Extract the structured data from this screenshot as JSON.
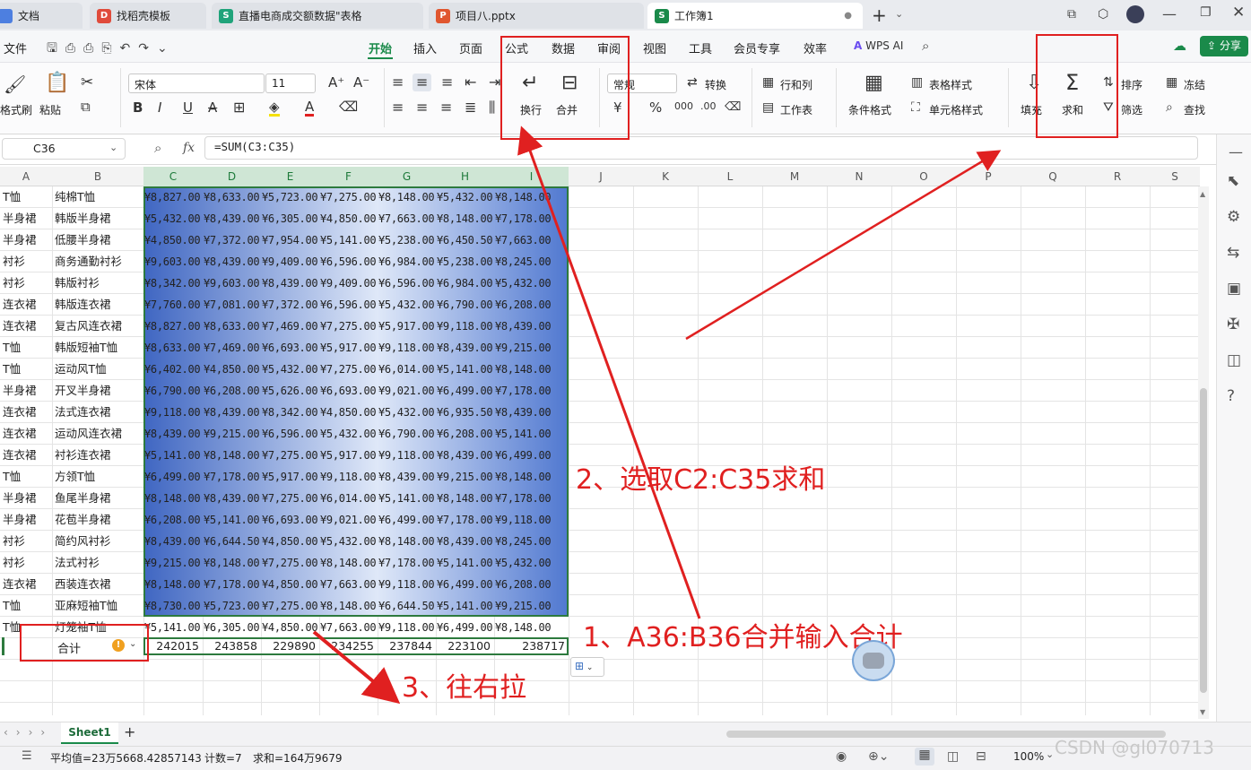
{
  "tabs": [
    {
      "label": "文档"
    },
    {
      "label": "找稻壳模板"
    },
    {
      "label": "直播电商成交额数据\"表格"
    },
    {
      "label": "项目八.pptx"
    },
    {
      "label": "工作簿1"
    }
  ],
  "menus": {
    "file": "文件",
    "items": [
      "开始",
      "插入",
      "页面",
      "公式",
      "数据",
      "审阅",
      "视图",
      "工具",
      "会员专享",
      "效率"
    ],
    "wps_ai": "WPS AI",
    "share": "分享"
  },
  "ribbon": {
    "format_painter": "格式刷",
    "paste": "粘贴",
    "font_name": "宋体",
    "font_size": "11",
    "wrap": "换行",
    "merge": "合并",
    "number_format": "常规",
    "convert": "转换",
    "rows_cols": "行和列",
    "worksheet": "工作表",
    "cond_format": "条件格式",
    "table_style": "表格样式",
    "cell_style": "单元格样式",
    "fill": "填充",
    "sum": "求和",
    "sort": "排序",
    "filter": "筛选",
    "freeze": "冻结",
    "find": "查找"
  },
  "formula_bar": {
    "cell_ref": "C36",
    "fx": "fx",
    "formula": "=SUM(C3:C35)"
  },
  "columns": [
    "A",
    "B",
    "C",
    "D",
    "E",
    "F",
    "G",
    "H",
    "I",
    "J",
    "K",
    "L",
    "M",
    "N",
    "O",
    "P",
    "Q",
    "R",
    "S"
  ],
  "rows": [
    [
      "T恤",
      "纯棉T恤",
      "¥8,827.00",
      "¥8,633.00",
      "¥5,723.00",
      "¥7,275.00",
      "¥8,148.00",
      "¥5,432.00",
      "¥8,148.00"
    ],
    [
      "半身裙",
      "韩版半身裙",
      "¥5,432.00",
      "¥8,439.00",
      "¥6,305.00",
      "¥4,850.00",
      "¥7,663.00",
      "¥8,148.00",
      "¥7,178.00"
    ],
    [
      "半身裙",
      "低腰半身裙",
      "¥4,850.00",
      "¥7,372.00",
      "¥7,954.00",
      "¥5,141.00",
      "¥5,238.00",
      "¥6,450.50",
      "¥7,663.00"
    ],
    [
      "衬衫",
      "商务通勤衬衫",
      "¥9,603.00",
      "¥8,439.00",
      "¥9,409.00",
      "¥6,596.00",
      "¥6,984.00",
      "¥5,238.00",
      "¥8,245.00"
    ],
    [
      "衬衫",
      "韩版衬衫",
      "¥8,342.00",
      "¥9,603.00",
      "¥8,439.00",
      "¥9,409.00",
      "¥6,596.00",
      "¥6,984.00",
      "¥5,432.00"
    ],
    [
      "连衣裙",
      "韩版连衣裙",
      "¥7,760.00",
      "¥7,081.00",
      "¥7,372.00",
      "¥6,596.00",
      "¥5,432.00",
      "¥6,790.00",
      "¥6,208.00"
    ],
    [
      "连衣裙",
      "复古风连衣裙",
      "¥8,827.00",
      "¥8,633.00",
      "¥7,469.00",
      "¥7,275.00",
      "¥5,917.00",
      "¥9,118.00",
      "¥8,439.00"
    ],
    [
      "T恤",
      "韩版短袖T恤",
      "¥8,633.00",
      "¥7,469.00",
      "¥6,693.00",
      "¥5,917.00",
      "¥9,118.00",
      "¥8,439.00",
      "¥9,215.00"
    ],
    [
      "T恤",
      "运动风T恤",
      "¥6,402.00",
      "¥4,850.00",
      "¥5,432.00",
      "¥7,275.00",
      "¥6,014.00",
      "¥5,141.00",
      "¥8,148.00"
    ],
    [
      "半身裙",
      "开叉半身裙",
      "¥6,790.00",
      "¥6,208.00",
      "¥5,626.00",
      "¥6,693.00",
      "¥9,021.00",
      "¥6,499.00",
      "¥7,178.00"
    ],
    [
      "连衣裙",
      "法式连衣裙",
      "¥9,118.00",
      "¥8,439.00",
      "¥8,342.00",
      "¥4,850.00",
      "¥5,432.00",
      "¥6,935.50",
      "¥8,439.00"
    ],
    [
      "连衣裙",
      "运动风连衣裙",
      "¥8,439.00",
      "¥9,215.00",
      "¥6,596.00",
      "¥5,432.00",
      "¥6,790.00",
      "¥6,208.00",
      "¥5,141.00"
    ],
    [
      "连衣裙",
      "衬衫连衣裙",
      "¥5,141.00",
      "¥8,148.00",
      "¥7,275.00",
      "¥5,917.00",
      "¥9,118.00",
      "¥8,439.00",
      "¥6,499.00"
    ],
    [
      "T恤",
      "方领T恤",
      "¥6,499.00",
      "¥7,178.00",
      "¥5,917.00",
      "¥9,118.00",
      "¥8,439.00",
      "¥9,215.00",
      "¥8,148.00"
    ],
    [
      "半身裙",
      "鱼尾半身裙",
      "¥8,148.00",
      "¥8,439.00",
      "¥7,275.00",
      "¥6,014.00",
      "¥5,141.00",
      "¥8,148.00",
      "¥7,178.00"
    ],
    [
      "半身裙",
      "花苞半身裙",
      "¥6,208.00",
      "¥5,141.00",
      "¥6,693.00",
      "¥9,021.00",
      "¥6,499.00",
      "¥7,178.00",
      "¥9,118.00"
    ],
    [
      "衬衫",
      "简约风衬衫",
      "¥8,439.00",
      "¥6,644.50",
      "¥4,850.00",
      "¥5,432.00",
      "¥8,148.00",
      "¥8,439.00",
      "¥8,245.00"
    ],
    [
      "衬衫",
      "法式衬衫",
      "¥9,215.00",
      "¥8,148.00",
      "¥7,275.00",
      "¥8,148.00",
      "¥7,178.00",
      "¥5,141.00",
      "¥5,432.00"
    ],
    [
      "连衣裙",
      "西装连衣裙",
      "¥8,148.00",
      "¥7,178.00",
      "¥4,850.00",
      "¥7,663.00",
      "¥9,118.00",
      "¥6,499.00",
      "¥6,208.00"
    ],
    [
      "T恤",
      "亚麻短袖T恤",
      "¥8,730.00",
      "¥5,723.00",
      "¥7,275.00",
      "¥8,148.00",
      "¥6,644.50",
      "¥5,141.00",
      "¥9,215.00"
    ],
    [
      "T恤",
      "灯笼袖T恤",
      "¥5,141.00",
      "¥6,305.00",
      "¥4,850.00",
      "¥7,663.00",
      "¥9,118.00",
      "¥6,499.00",
      "¥8,148.00"
    ]
  ],
  "total_row": {
    "label": "合计",
    "values": [
      "242015",
      "243858",
      "229890",
      "234255",
      "237844",
      "223100",
      "238717"
    ]
  },
  "sheet_tab": "Sheet1",
  "status": {
    "avg": "平均值=23万5668.42857143",
    "count": "计数=7",
    "sum": "求和=164万9679",
    "zoom": "100%"
  },
  "annotations": {
    "step1": "1、A36:B36合并输入合计",
    "step2": "2、选取C2:C35求和",
    "step3": "3、往右拉",
    "watermark": "CSDN @gl070713"
  },
  "colors": {
    "accent": "#1a8a4a",
    "annot": "#e02020",
    "cell_blue": "#4a72c8"
  }
}
